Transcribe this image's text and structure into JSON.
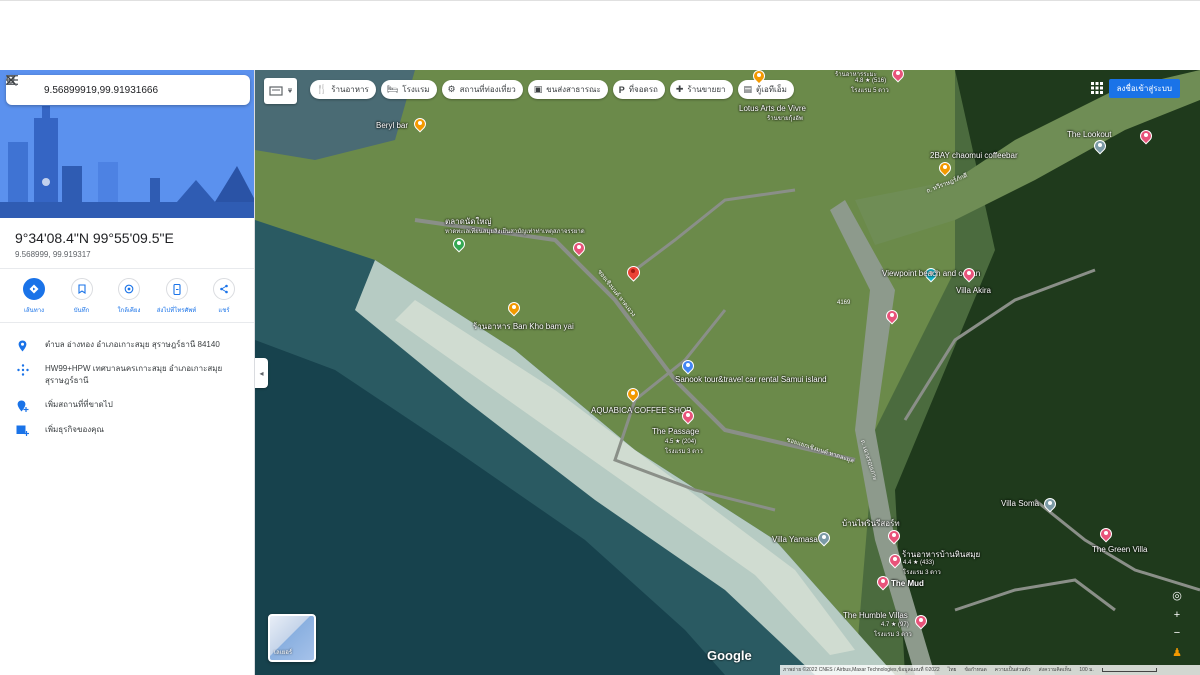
{
  "search": {
    "value": "9.56899919,99.91931666"
  },
  "place": {
    "dms": "9°34'08.4\"N 99°55'09.5\"E",
    "decimal": "9.568999, 99.919317"
  },
  "actions": [
    {
      "label": "เส้นทาง",
      "icon": "directions-icon"
    },
    {
      "label": "บันทึก",
      "icon": "bookmark-icon"
    },
    {
      "label": "ใกล้เคียง",
      "icon": "nearby-icon"
    },
    {
      "label": "ส่งไปที่โทรศัพท์",
      "icon": "phone-icon"
    },
    {
      "label": "แชร์",
      "icon": "share-icon"
    }
  ],
  "info": {
    "address": "ตำบล อ่างทอง อำเภอเกาะสมุย สุราษฎร์ธานี 84140",
    "plus_code": "HW99+HPW เทศบาลนครเกาะสมุย อำเภอเกาะสมุย สุราษฎร์ธานี",
    "add_place": "เพิ่มสถานที่ที่ขาดไป",
    "add_business": "เพิ่มธุรกิจของคุณ"
  },
  "chips": [
    {
      "label": "ร้านอาหาร",
      "icon": "restaurant-icon"
    },
    {
      "label": "โรงแรม",
      "icon": "hotel-icon"
    },
    {
      "label": "สถานที่ท่องเที่ยว",
      "icon": "attraction-icon"
    },
    {
      "label": "ขนส่งสาธารณะ",
      "icon": "transit-icon"
    },
    {
      "label": "ที่จอดรถ",
      "icon": "parking-icon"
    },
    {
      "label": "ร้านขายยา",
      "icon": "pharmacy-icon"
    },
    {
      "label": "ตู้เอทีเอ็ม",
      "icon": "atm-icon"
    }
  ],
  "signin": "ลงชื่อเข้าสู่ระบบ",
  "map_labels": {
    "beryl_bar": "Beryl bar",
    "lotus": "Lotus Arts de Vivre",
    "lotus_sub": "ร้านขายกุ้งอัพ",
    "top_place": "ร้านอาหารระมะ",
    "top_rating": "4.8 ★ (516)",
    "top_sub": "โรงแรม 5 ดาว",
    "lookout": "The Lookout",
    "chaomui": "2BAY chaomui coffeebar",
    "market": "ตลาดนัดใหญ่",
    "market_sub": "หาดทะเลเทียนสมุยลิงเยีนสามัญเท่าท่าเหตุสภาจรรยาด",
    "ban_kho": "ร้านอาหาร Ban Kho bam yai",
    "viewpoint": "Viewpoint beach and ocean",
    "villa_akira": "Villa Akira",
    "sanook": "Sanook tour&travel car rental Samui island",
    "aquabica": "AQUABICA COFFEE SHOP",
    "passage": "The Passage",
    "passage_rating": "4.5 ★ (204)",
    "passage_sub": "โรงแรม 3 ดาว",
    "villa_soma": "Villa Soma",
    "baan_prin": "บ้านไพรินรีสอร์ท",
    "villa_yamasa": "Villa Yamasa",
    "baan_hin": "ร้านอาหารบ้านหินสมุย",
    "baan_hin_rating": "4.4 ★ (433)",
    "baan_hin_sub": "โรงแรม 3 ดาว",
    "green_villa": "The Green Villa",
    "the_mud": "The Mud",
    "humble": "The Humble Villas",
    "humble_rating": "4.7 ★ (97)",
    "humble_sub": "โรงแรม 3 ดาว",
    "road1": "ซอยเชิงมนต์ หาดเฉวง",
    "road2": "ซอยแยกเชิงมนต์ หาดละมุล",
    "road3": "ถ. เฉวงรอบเกาะ",
    "road4": "ถ. ทวีราษฎร์ภักดี",
    "road5": "4169"
  },
  "satellite_label": "เลเยอร์",
  "google": "Google",
  "footer": {
    "imagery": "ภาพถ่าย ©2022 CNES / Airbus,Maxar Technologies,ข้อมูลแผนที่ ©2022",
    "thailand": "ไทย",
    "terms": "ข้อกำหนด",
    "privacy": "ความเป็นส่วนตัว",
    "feedback": "ส่งความคิดเห็น",
    "scale": "100 ม."
  }
}
